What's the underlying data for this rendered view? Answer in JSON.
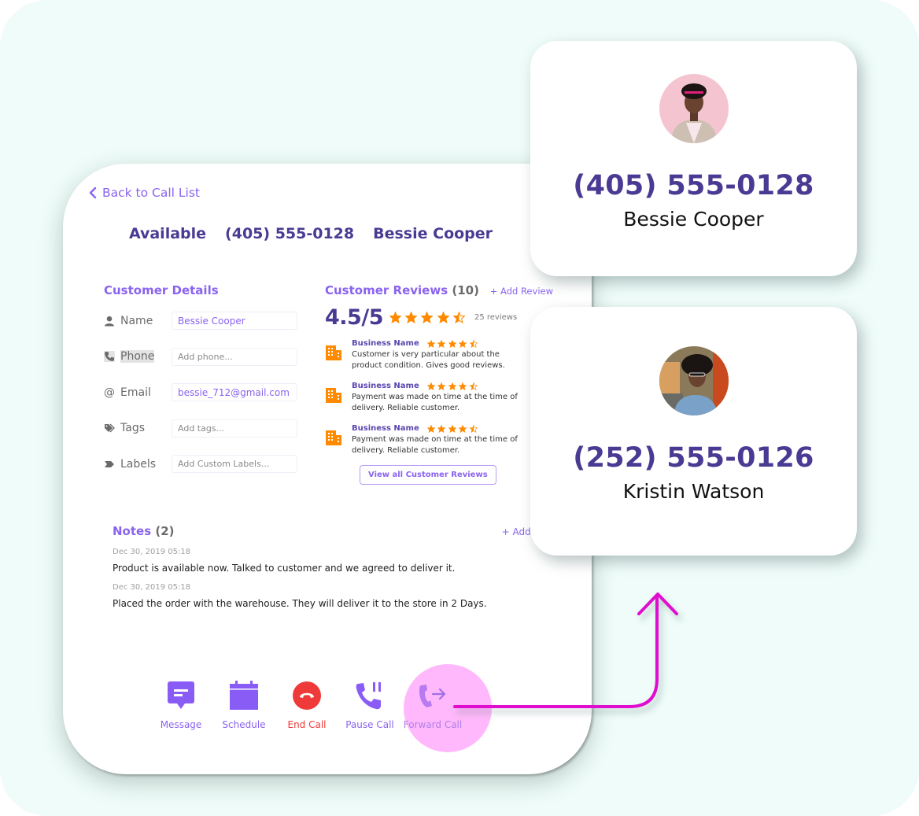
{
  "back_link": {
    "label": "Back to Call List"
  },
  "call_header": {
    "status": "Available",
    "phone": "(405) 555-0128",
    "name": "Bessie Cooper"
  },
  "customer_details": {
    "title": "Customer Details",
    "fields": [
      {
        "label": "Name",
        "icon": "person-icon",
        "value": "Bessie Cooper",
        "placeholder": ""
      },
      {
        "label": "Phone",
        "icon": "phone-icon",
        "value": "",
        "placeholder": "Add phone..."
      },
      {
        "label": "Email",
        "icon": "at-icon",
        "value": "bessie_712@gmail.com",
        "placeholder": ""
      },
      {
        "label": "Tags",
        "icon": "tags-icon",
        "value": "",
        "placeholder": "Add tags..."
      },
      {
        "label": "Labels",
        "icon": "label-icon",
        "value": "",
        "placeholder": "Add Custom Labels..."
      }
    ]
  },
  "reviews": {
    "title": "Customer Reviews",
    "count": "(10)",
    "add_label": "+ Add Review",
    "rating": "4.5/5",
    "rating_stars": 4.5,
    "rating_count": "25 reviews",
    "items": [
      {
        "business": "Business Name",
        "stars": 4.5,
        "text": "Customer is very particular about the product condition. Gives good reviews."
      },
      {
        "business": "Business Name",
        "stars": 4.5,
        "text": "Payment was made on time at the time of delivery. Reliable customer."
      },
      {
        "business": "Business Name",
        "stars": 4.5,
        "text": "Payment was made on time at the time of delivery. Reliable customer."
      }
    ],
    "view_all_label": "View all Customer Reviews"
  },
  "notes": {
    "title": "Notes",
    "count": "(2)",
    "add_label": "+ Add Note",
    "items": [
      {
        "date": "Dec 30, 2019 05:18",
        "text": "Product is available now. Talked to customer and we agreed to deliver it."
      },
      {
        "date": "Dec 30, 2019 05:18",
        "text": "Placed the order with the warehouse. They will deliver it to the store in 2 Days."
      }
    ]
  },
  "actions": [
    {
      "label": "Message",
      "icon": "message-icon"
    },
    {
      "label": "Schedule",
      "icon": "calendar-icon"
    },
    {
      "label": "End Call",
      "icon": "end-call-icon"
    },
    {
      "label": "Pause Call",
      "icon": "pause-call-icon"
    },
    {
      "label": "Forward Call",
      "icon": "forward-call-icon"
    }
  ],
  "contacts": [
    {
      "phone": "(405) 555-0128",
      "name": "Bessie Cooper"
    },
    {
      "phone": "(252) 555-0126",
      "name": "Kristin Watson"
    }
  ],
  "colors": {
    "accent": "#8a63f0",
    "heading": "#4a3a93",
    "danger": "#ef3a3a",
    "star": "#ff8a00",
    "highlight": "#ffb8fb",
    "arrow": "#e010d0",
    "background": "#effcf9"
  }
}
